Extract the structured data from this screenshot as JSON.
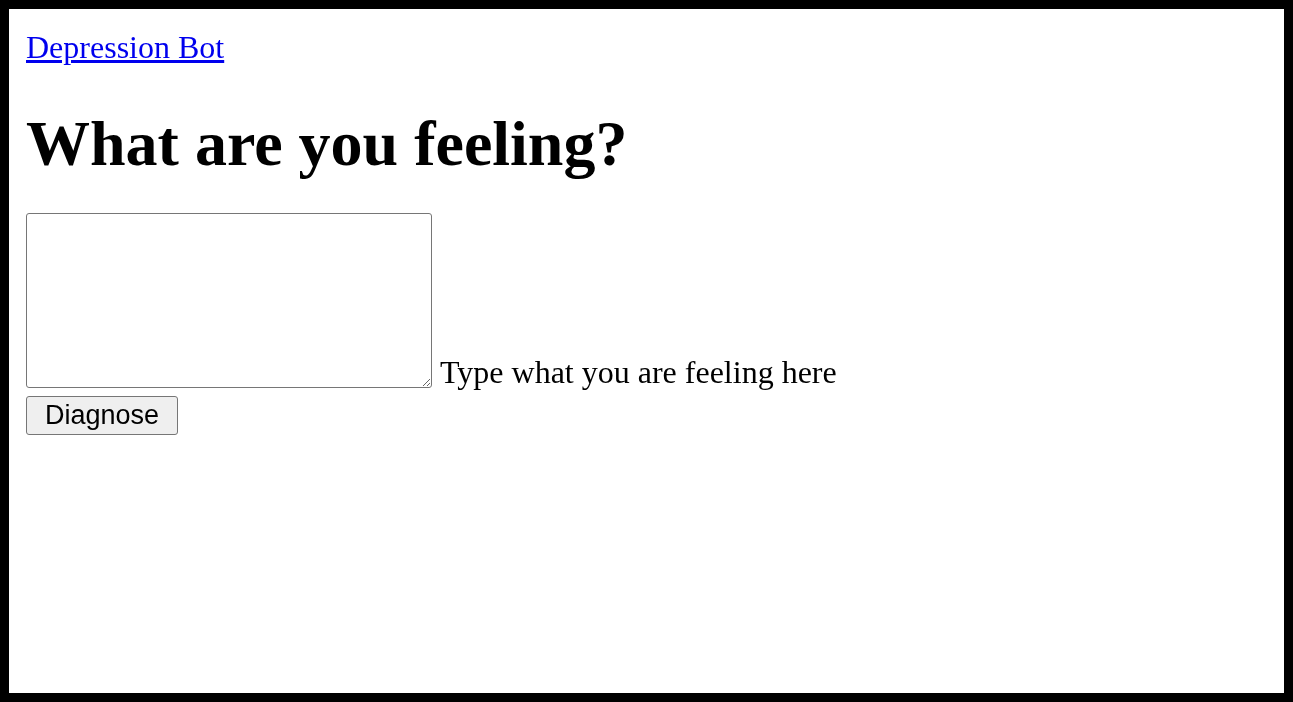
{
  "link": {
    "label": "Depression Bot"
  },
  "heading": "What are you feeling?",
  "feeling_field": {
    "label": "Type what you are feeling here"
  },
  "button": {
    "label": "Diagnose"
  }
}
